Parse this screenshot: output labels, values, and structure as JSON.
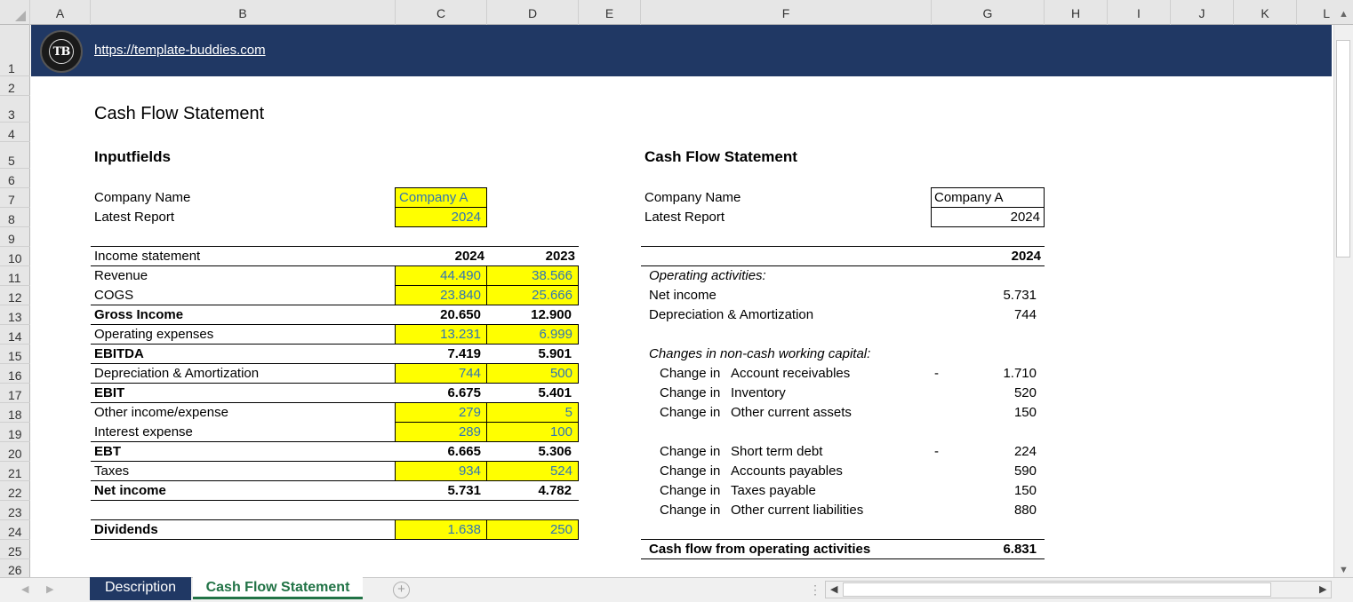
{
  "columns": [
    "A",
    "B",
    "C",
    "D",
    "E",
    "F",
    "G",
    "H",
    "I",
    "J",
    "K",
    "L"
  ],
  "rows": [
    "1",
    "2",
    "3",
    "4",
    "5",
    "6",
    "7",
    "8",
    "9",
    "10",
    "11",
    "12",
    "13",
    "14",
    "15",
    "16",
    "17",
    "18",
    "19",
    "20",
    "21",
    "22",
    "23",
    "24",
    "25",
    "26"
  ],
  "banner": {
    "logo_text": "TB",
    "url": "https://template-buddies.com"
  },
  "title": "Cash Flow Statement",
  "left": {
    "heading": "Inputfields",
    "company_label": "Company Name",
    "company_value": "Company A",
    "report_label": "Latest Report",
    "report_value": "2024",
    "table_header": {
      "label": "Income statement",
      "y1": "2024",
      "y2": "2023"
    },
    "rows": [
      {
        "label": "Revenue",
        "v1": "44.490",
        "v2": "38.566"
      },
      {
        "label": "COGS",
        "v1": "23.840",
        "v2": "25.666"
      },
      {
        "label": "Gross Income",
        "v1": "20.650",
        "v2": "12.900"
      },
      {
        "label": "Operating expenses",
        "v1": "13.231",
        "v2": "6.999"
      },
      {
        "label": "EBITDA",
        "v1": "7.419",
        "v2": "5.901"
      },
      {
        "label": "Depreciation & Amortization",
        "v1": "744",
        "v2": "500"
      },
      {
        "label": "EBIT",
        "v1": "6.675",
        "v2": "5.401"
      },
      {
        "label": "Other income/expense",
        "v1": "279",
        "v2": "5"
      },
      {
        "label": "Interest expense",
        "v1": "289",
        "v2": "100"
      },
      {
        "label": "EBT",
        "v1": "6.665",
        "v2": "5.306"
      },
      {
        "label": "Taxes",
        "v1": "934",
        "v2": "524"
      },
      {
        "label": "Net income",
        "v1": "5.731",
        "v2": "4.782"
      }
    ],
    "dividends": {
      "label": "Dividends",
      "v1": "1.638",
      "v2": "250"
    }
  },
  "right": {
    "heading": "Cash Flow Statement",
    "company_label": "Company Name",
    "company_value": "Company A",
    "report_label": "Latest Report",
    "report_value": "2024",
    "year": "2024",
    "op_heading": "Operating activities:",
    "net_income": {
      "label": "Net income",
      "value": "5.731"
    },
    "dep": {
      "label": "Depreciation & Amortization",
      "value": "744"
    },
    "wc_heading": "Changes in non-cash working capital:",
    "change_prefix": "Change in",
    "wc_rows": [
      {
        "label": "Account receivables",
        "sign": "-",
        "value": "1.710"
      },
      {
        "label": "Inventory",
        "sign": "",
        "value": "520"
      },
      {
        "label": "Other current assets",
        "sign": "",
        "value": "150"
      },
      {
        "label": "Short term debt",
        "sign": "-",
        "value": "224"
      },
      {
        "label": "Accounts payables",
        "sign": "",
        "value": "590"
      },
      {
        "label": "Taxes payable",
        "sign": "",
        "value": "150"
      },
      {
        "label": "Other current liabilities",
        "sign": "",
        "value": "880"
      }
    ],
    "total": {
      "label": "Cash flow from operating activities",
      "value": "6.831"
    }
  },
  "tabs": {
    "tab1": "Description",
    "tab2": "Cash Flow Statement"
  },
  "colors": {
    "banner": "#203864",
    "input_fill": "#ffff00",
    "input_text": "#2f75b5",
    "active_tab_text": "#217346"
  }
}
